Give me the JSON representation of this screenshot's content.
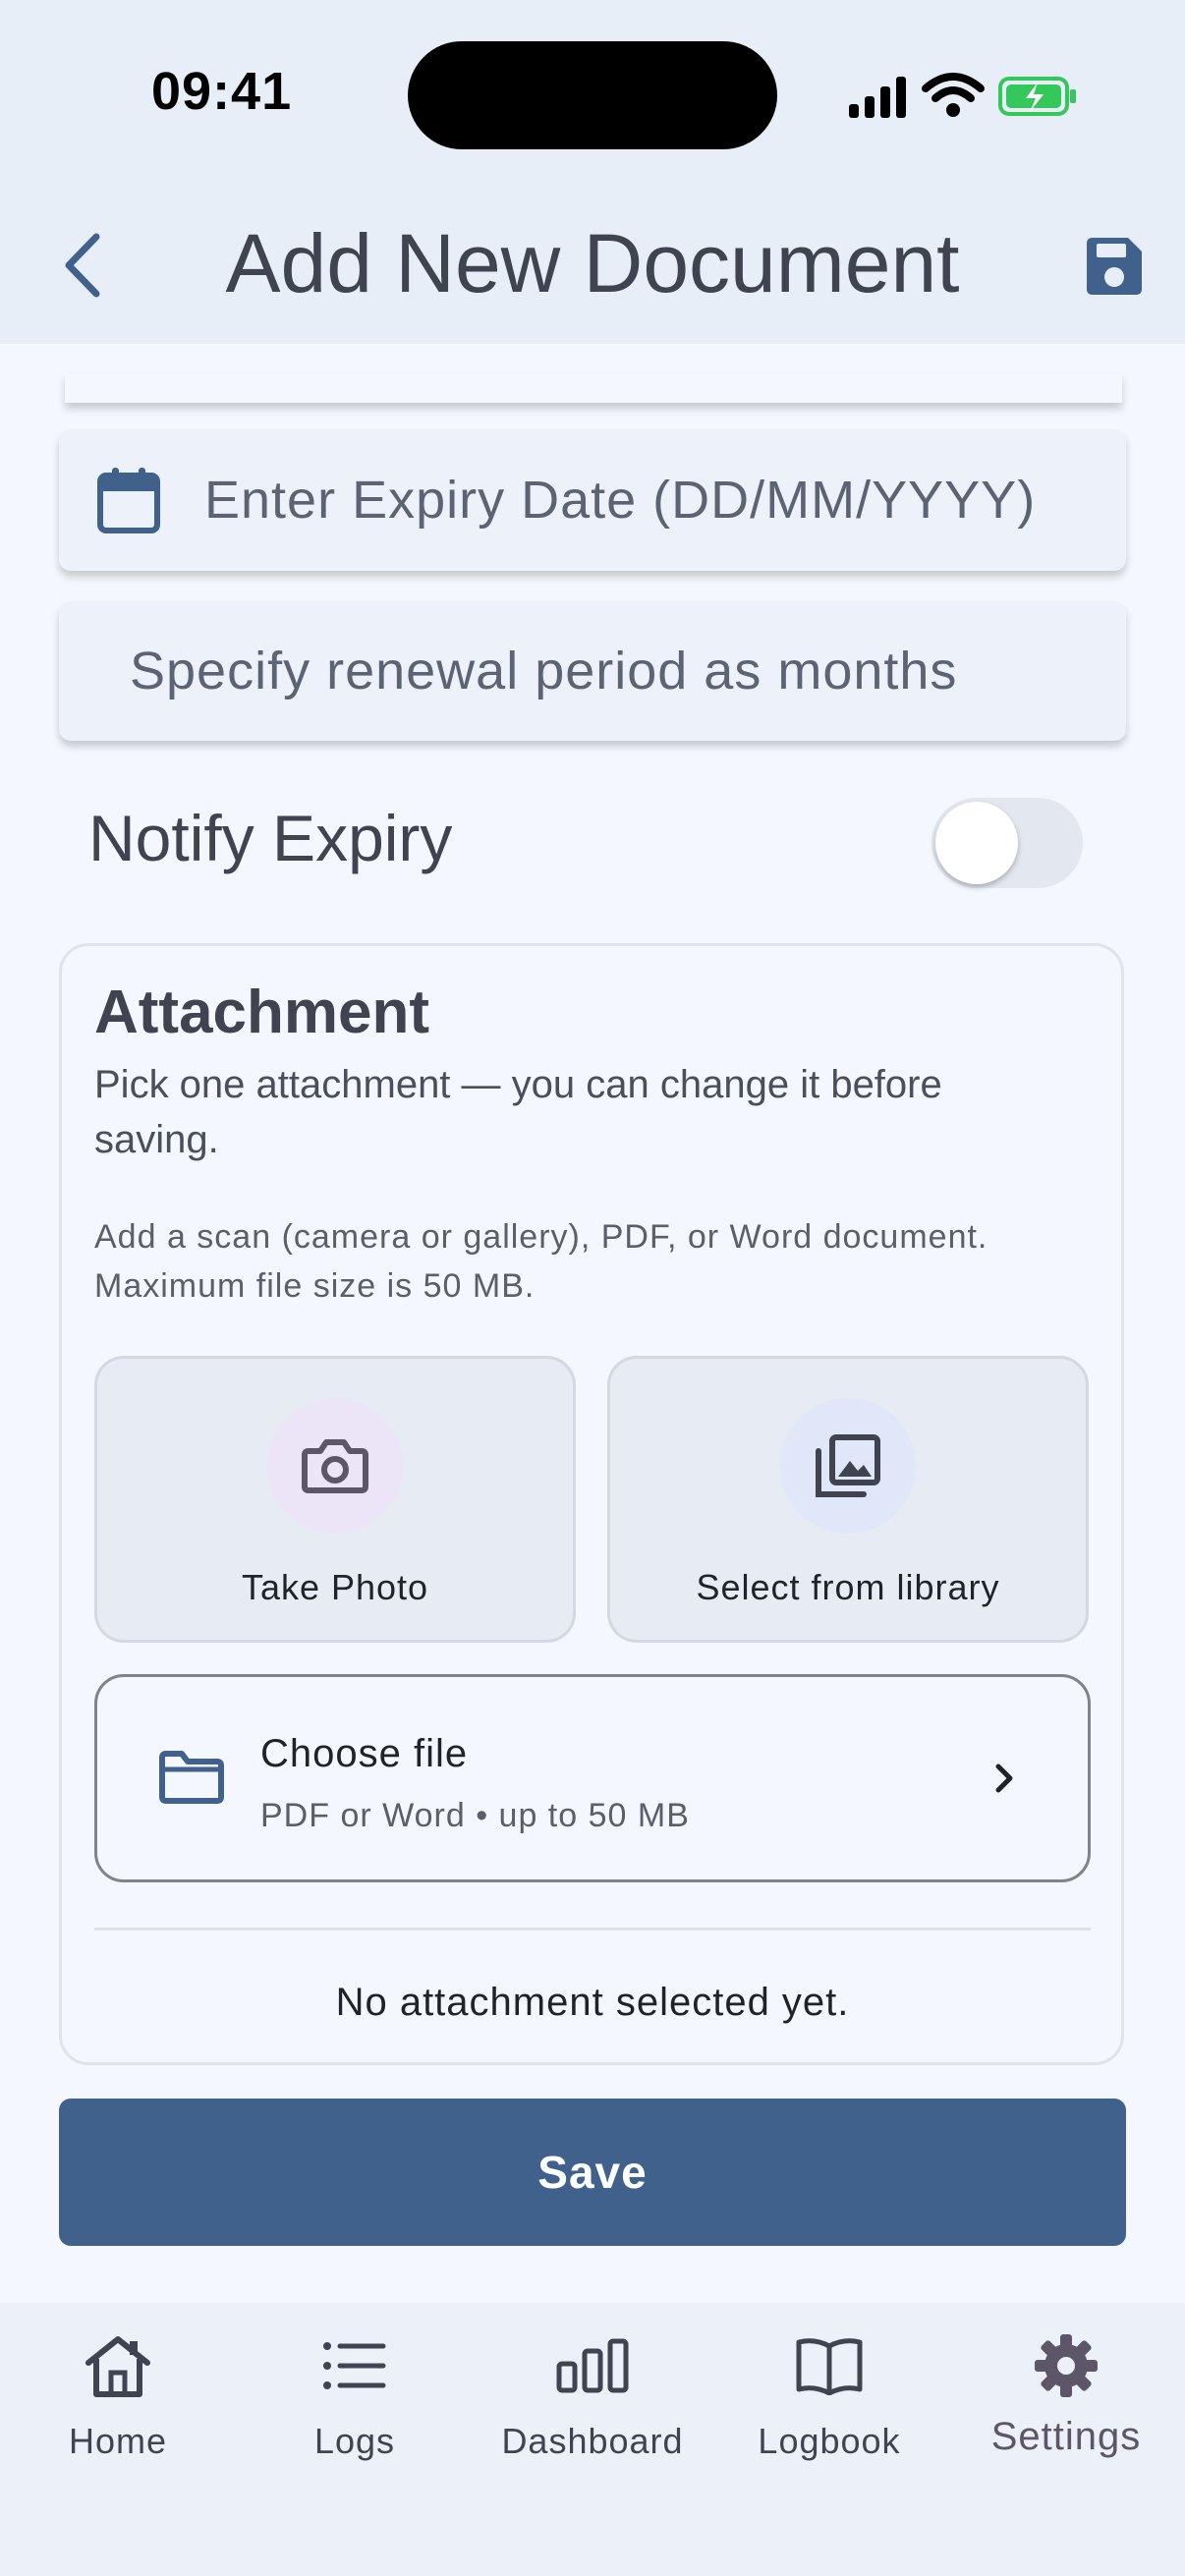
{
  "status_bar": {
    "time": "09:41"
  },
  "header": {
    "title": "Add New Document"
  },
  "form": {
    "expiry_placeholder": "Enter Expiry Date (DD/MM/YYYY)",
    "renewal_placeholder": "Specify renewal period as months",
    "notify_label": "Notify Expiry",
    "notify_enabled": false
  },
  "attachment": {
    "title": "Attachment",
    "subtitle": "Pick one attachment — you can change it before saving.",
    "help": "Add a scan (camera or gallery), PDF, or Word document. Maximum file size is 50 MB.",
    "take_photo_label": "Take Photo",
    "library_label": "Select from library",
    "choose_file_title": "Choose file",
    "choose_file_sub": "PDF or Word • up to 50 MB",
    "empty_message": "No attachment selected yet."
  },
  "save_label": "Save",
  "tabs": [
    {
      "label": "Home",
      "icon": "home-icon"
    },
    {
      "label": "Logs",
      "icon": "list-icon"
    },
    {
      "label": "Dashboard",
      "icon": "bar-chart-icon"
    },
    {
      "label": "Logbook",
      "icon": "book-icon"
    },
    {
      "label": "Settings",
      "icon": "gear-icon"
    }
  ],
  "active_tab": "Settings",
  "colors": {
    "primary": "#3f618c",
    "header_bg": "#e8eef8",
    "page_bg": "#f4f7fd",
    "battery": "#34c759"
  }
}
